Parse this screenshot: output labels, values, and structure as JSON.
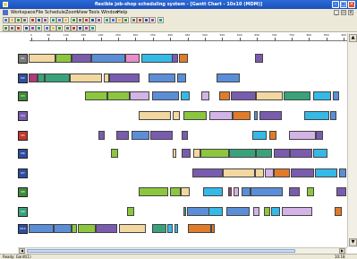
{
  "window": {
    "title": "flexible job-shop scheduling system - [Gantt Chart - 10x10 (MDM)]"
  },
  "menu": [
    "Workspace",
    "File",
    "Schedule",
    "Zoom",
    "View",
    "Tools",
    "Window",
    "Help"
  ],
  "toolbar_icons": [
    "new-icon",
    "open-icon",
    "save-icon",
    "print-icon",
    "cut-icon",
    "copy-icon",
    "paste-icon",
    "undo-icon",
    "redo-icon",
    "zoom-in-icon",
    "zoom-out-icon",
    "gantt-icon",
    "table-icon",
    "chart-icon",
    "grid-icon",
    "filter-icon",
    "sort-icon",
    "refresh-icon",
    "help-icon",
    "play-icon",
    "pause-icon",
    "stop-icon",
    "step-icon",
    "options-icon"
  ],
  "ruler": {
    "ticks": [
      "0",
      "50",
      "100",
      "150",
      "200",
      "250",
      "300",
      "350",
      "400",
      "450",
      "500",
      "550",
      "600",
      "650",
      "700",
      "750",
      "800",
      "850",
      "900"
    ]
  },
  "colors": {
    "tan": "#f2d7a0",
    "blue": "#5b8ed6",
    "green": "#8cc63f",
    "purple": "#7a5cae",
    "pink": "#e58ec9",
    "cyan": "#35b9e6",
    "orange": "#e07b2a",
    "teal": "#3aa27a",
    "magenta": "#b03a78",
    "lilac": "#d2b4e6",
    "navy": "#2f4ea0",
    "gray": "#8a8a8a"
  },
  "machines": [
    {
      "id": "M1",
      "color": "#7a7a7a"
    },
    {
      "id": "M2",
      "color": "#2f4ea0"
    },
    {
      "id": "M3",
      "color": "#3e8c3a"
    },
    {
      "id": "M4",
      "color": "#7a5cae"
    },
    {
      "id": "M5",
      "color": "#c0392b"
    },
    {
      "id": "M6",
      "color": "#2f4ea0"
    },
    {
      "id": "M7",
      "color": "#2f4ea0"
    },
    {
      "id": "M8",
      "color": "#3e8c3a"
    },
    {
      "id": "M9",
      "color": "#3aa27a"
    },
    {
      "id": "M10",
      "color": "#2f4ea0"
    }
  ],
  "schedule": [
    [
      [
        12,
        30,
        "tan"
      ],
      [
        42,
        18,
        "green"
      ],
      [
        60,
        22,
        "purple"
      ],
      [
        82,
        38,
        "blue"
      ],
      [
        120,
        16,
        "pink"
      ],
      [
        138,
        35,
        "cyan"
      ],
      [
        172,
        7,
        "purple"
      ],
      [
        180,
        10,
        "orange"
      ],
      [
        265,
        9,
        "purple"
      ]
    ],
    [
      [
        12,
        10,
        "magenta"
      ],
      [
        22,
        8,
        "teal"
      ],
      [
        30,
        28,
        "teal"
      ],
      [
        58,
        36,
        "tan"
      ],
      [
        96,
        6,
        "tan"
      ],
      [
        102,
        34,
        "purple"
      ],
      [
        146,
        30,
        "blue"
      ],
      [
        178,
        10,
        "blue"
      ],
      [
        222,
        26,
        "blue"
      ]
    ],
    [
      [
        75,
        25,
        "green"
      ],
      [
        100,
        25,
        "green"
      ],
      [
        125,
        22,
        "lilac"
      ],
      [
        150,
        30,
        "blue"
      ],
      [
        182,
        10,
        "cyan"
      ],
      [
        205,
        9,
        "lilac"
      ],
      [
        225,
        12,
        "orange"
      ],
      [
        238,
        28,
        "purple"
      ],
      [
        266,
        30,
        "tan"
      ],
      [
        297,
        30,
        "teal"
      ],
      [
        330,
        20,
        "cyan"
      ],
      [
        352,
        7,
        "blue"
      ]
    ],
    [
      [
        135,
        36,
        "tan"
      ],
      [
        173,
        8,
        "tan"
      ],
      [
        185,
        26,
        "green"
      ],
      [
        214,
        26,
        "lilac"
      ],
      [
        240,
        20,
        "orange"
      ],
      [
        264,
        4,
        "blue"
      ],
      [
        270,
        25,
        "purple"
      ],
      [
        320,
        28,
        "cyan"
      ],
      [
        349,
        7,
        "blue"
      ]
    ],
    [
      [
        90,
        7,
        "purple"
      ],
      [
        110,
        14,
        "purple"
      ],
      [
        127,
        20,
        "blue"
      ],
      [
        148,
        25,
        "purple"
      ],
      [
        183,
        7,
        "purple"
      ],
      [
        262,
        16,
        "cyan"
      ],
      [
        281,
        8,
        "orange"
      ],
      [
        303,
        30,
        "lilac"
      ],
      [
        333,
        8,
        "purple"
      ]
    ],
    [
      [
        104,
        8,
        "green"
      ],
      [
        173,
        4,
        "tan"
      ],
      [
        183,
        10,
        "purple"
      ],
      [
        196,
        8,
        "tan"
      ],
      [
        204,
        32,
        "green"
      ],
      [
        236,
        30,
        "teal"
      ],
      [
        266,
        18,
        "teal"
      ],
      [
        286,
        18,
        "purple"
      ],
      [
        304,
        25,
        "purple"
      ],
      [
        330,
        16,
        "cyan"
      ]
    ],
    [
      [
        195,
        34,
        "purple"
      ],
      [
        229,
        36,
        "tan"
      ],
      [
        265,
        10,
        "tan"
      ],
      [
        276,
        10,
        "lilac"
      ],
      [
        286,
        18,
        "orange"
      ],
      [
        305,
        26,
        "purple"
      ],
      [
        332,
        25,
        "cyan"
      ],
      [
        359,
        8,
        "blue"
      ]
    ],
    [
      [
        135,
        33,
        "green"
      ],
      [
        170,
        12,
        "green"
      ],
      [
        182,
        10,
        "tan"
      ],
      [
        207,
        22,
        "cyan"
      ],
      [
        235,
        4,
        "magenta"
      ],
      [
        241,
        6,
        "lilac"
      ],
      [
        250,
        10,
        "blue"
      ],
      [
        260,
        36,
        "blue"
      ],
      [
        303,
        12,
        "purple"
      ],
      [
        323,
        8,
        "green"
      ],
      [
        356,
        11,
        "purple"
      ]
    ],
    [
      [
        122,
        8,
        "green"
      ],
      [
        185,
        3,
        "teal"
      ],
      [
        189,
        25,
        "blue"
      ],
      [
        213,
        16,
        "cyan"
      ],
      [
        233,
        26,
        "blue"
      ],
      [
        263,
        7,
        "lilac"
      ],
      [
        275,
        7,
        "green"
      ],
      [
        283,
        10,
        "cyan"
      ],
      [
        295,
        34,
        "lilac"
      ],
      [
        354,
        8,
        "orange"
      ]
    ],
    [
      [
        12,
        28,
        "blue"
      ],
      [
        40,
        20,
        "blue"
      ],
      [
        60,
        6,
        "green"
      ],
      [
        67,
        20,
        "green"
      ],
      [
        87,
        24,
        "purple"
      ],
      [
        113,
        30,
        "tan"
      ],
      [
        150,
        16,
        "teal"
      ],
      [
        167,
        6,
        "cyan"
      ],
      [
        175,
        4,
        "cyan"
      ],
      [
        190,
        26,
        "orange"
      ],
      [
        216,
        4,
        "orange"
      ]
    ]
  ],
  "status": {
    "text": "Ready: Gantt(1)",
    "time": "10:18"
  }
}
